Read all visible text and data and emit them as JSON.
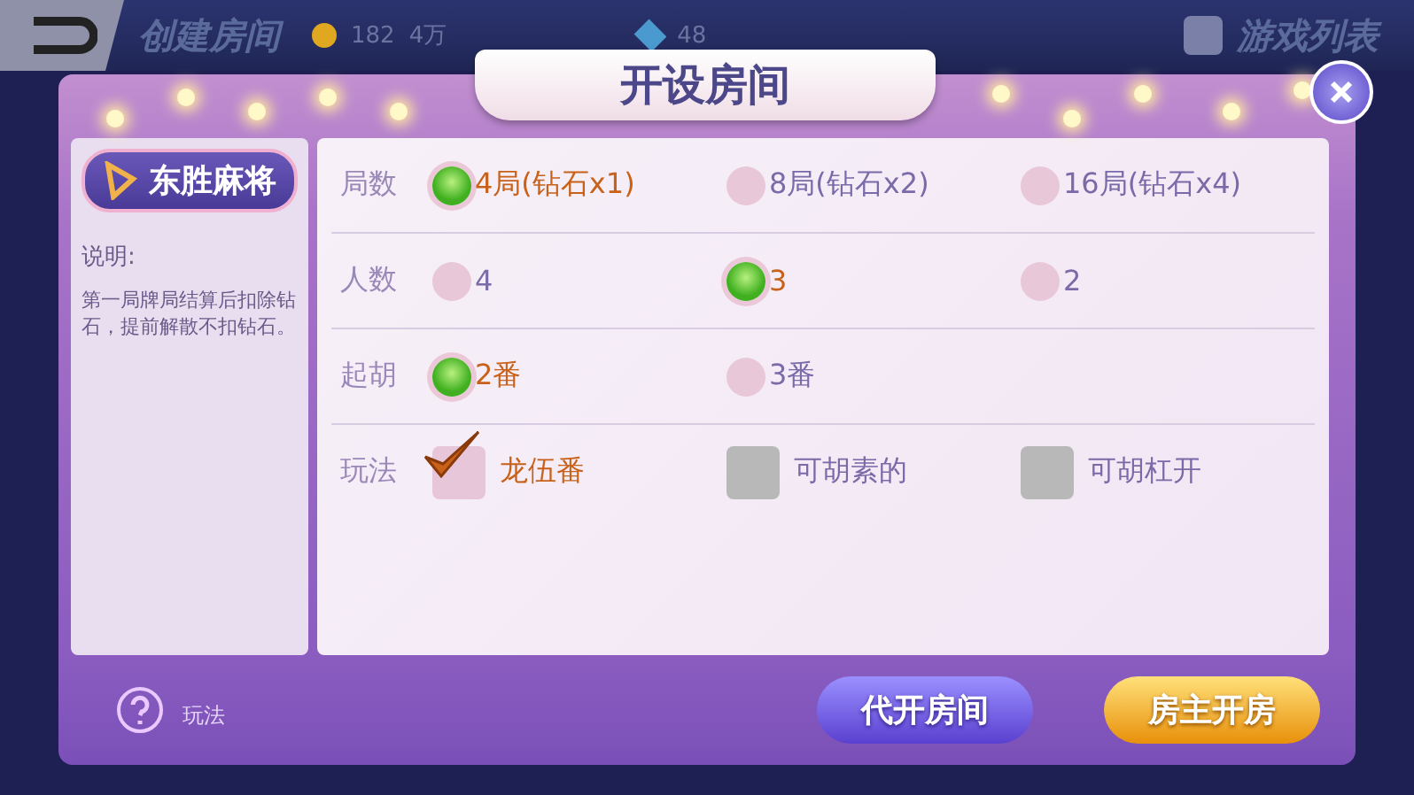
{
  "top_bar": {
    "title": "创建房间",
    "gold": "182",
    "gold_unit": "4万",
    "diamonds": "48",
    "game_list": "游戏列表"
  },
  "dialog": {
    "title": "开设房间",
    "game": {
      "name": "东胜麻将",
      "note_label": "说明:",
      "note": "第一局牌局结算后扣除钻石，提前解散不扣钻石。"
    },
    "settings": [
      {
        "label": "局数",
        "kind": "radio",
        "options": [
          {
            "text": "4局(钻石x1)",
            "selected": true
          },
          {
            "text": "8局(钻石x2)",
            "selected": false
          },
          {
            "text": "16局(钻石x4)",
            "selected": false
          }
        ]
      },
      {
        "label": "人数",
        "kind": "radio",
        "options": [
          {
            "text": "4",
            "selected": false
          },
          {
            "text": "3",
            "selected": true
          },
          {
            "text": "2",
            "selected": false
          }
        ]
      },
      {
        "label": "起胡",
        "kind": "radio",
        "options": [
          {
            "text": "2番",
            "selected": true
          },
          {
            "text": "3番",
            "selected": false
          }
        ]
      },
      {
        "label": "玩法",
        "kind": "checkbox",
        "options": [
          {
            "text": "龙伍番",
            "checked": true
          },
          {
            "text": "可胡素的",
            "checked": false
          },
          {
            "text": "可胡杠开",
            "checked": false
          }
        ]
      }
    ],
    "help": "玩法",
    "buttons": [
      {
        "label": "代开房间",
        "kind": "secondary"
      },
      {
        "label": "房主开房",
        "kind": "primary"
      }
    ]
  }
}
